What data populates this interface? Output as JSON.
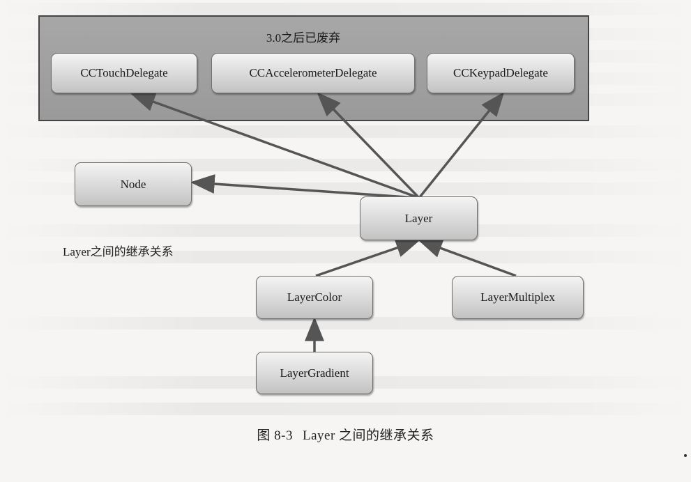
{
  "group": {
    "label": "3.0之后已废弃"
  },
  "nodes": {
    "touch": "CCTouchDelegate",
    "accel": "CCAccelerometerDelegate",
    "keypad": "CCKeypadDelegate",
    "node": "Node",
    "layer": "Layer",
    "color": "LayerColor",
    "multi": "LayerMultiplex",
    "grad": "LayerGradient"
  },
  "side_label": "Layer之间的继承关系",
  "caption": {
    "number": "图 8-3",
    "text": "Layer 之间的继承关系"
  },
  "colors": {
    "arrow": "#555555",
    "group_fill": "#a0a0a0",
    "node_fill": "#d9d9d9"
  },
  "edges": [
    {
      "from": "layer",
      "to": "touch"
    },
    {
      "from": "layer",
      "to": "accel"
    },
    {
      "from": "layer",
      "to": "keypad"
    },
    {
      "from": "layer",
      "to": "node"
    },
    {
      "from": "color",
      "to": "layer"
    },
    {
      "from": "multi",
      "to": "layer"
    },
    {
      "from": "grad",
      "to": "color"
    }
  ]
}
